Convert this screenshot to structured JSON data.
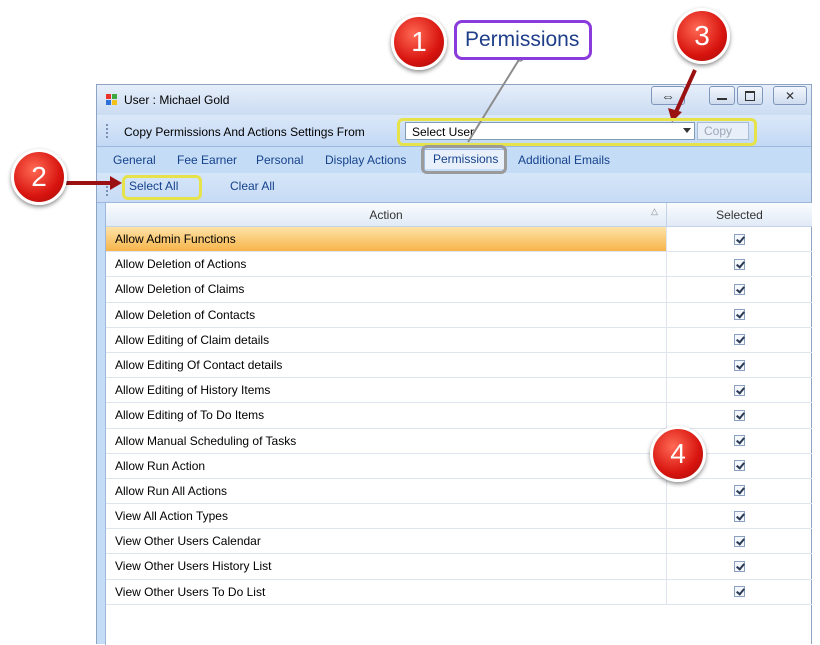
{
  "window": {
    "title": "User : Michael Gold",
    "buttons": [
      "minimize-icon",
      "maximize-icon",
      "close-icon"
    ],
    "resize_glyph": "⇔"
  },
  "toolbar": {
    "copy_label": "Copy Permissions And Actions Settings From",
    "select_user_value": "Select User",
    "copy_button": "Copy"
  },
  "tabs": [
    {
      "label": "General"
    },
    {
      "label": "Fee Earner"
    },
    {
      "label": "Personal"
    },
    {
      "label": "Display Actions"
    },
    {
      "label": "Permissions",
      "active": true
    },
    {
      "label": "Additional Emails"
    }
  ],
  "actions_bar": {
    "select_all": "Select All",
    "clear_all": "Clear All"
  },
  "grid": {
    "columns": [
      "Action",
      "Selected"
    ],
    "rows": [
      {
        "action": "Allow Admin Functions",
        "selected": true,
        "highlighted": true
      },
      {
        "action": "Allow Deletion of Actions",
        "selected": true
      },
      {
        "action": "Allow Deletion of Claims",
        "selected": true
      },
      {
        "action": "Allow Deletion of Contacts",
        "selected": true
      },
      {
        "action": "Allow Editing of Claim details",
        "selected": true
      },
      {
        "action": "Allow Editing Of Contact details",
        "selected": true
      },
      {
        "action": "Allow Editing of History Items",
        "selected": true
      },
      {
        "action": "Allow Editing of To Do Items",
        "selected": true
      },
      {
        "action": "Allow Manual Scheduling of Tasks",
        "selected": true
      },
      {
        "action": "Allow Run Action",
        "selected": true
      },
      {
        "action": "Allow Run All Actions",
        "selected": true
      },
      {
        "action": "View All Action Types",
        "selected": true
      },
      {
        "action": "View Other Users Calendar",
        "selected": true
      },
      {
        "action": "View Other Users History List",
        "selected": true
      },
      {
        "action": "View Other Users To Do List",
        "selected": true
      }
    ]
  },
  "annotations": {
    "callout_text": "Permissions",
    "markers": [
      "1",
      "2",
      "3",
      "4"
    ],
    "callout_color": "#e6e34a",
    "marker_color": "#d8140f"
  },
  "colors": {
    "window_bg": "#c5dcf7",
    "text": "#15428b",
    "row_highlight": "#f7b44a"
  }
}
